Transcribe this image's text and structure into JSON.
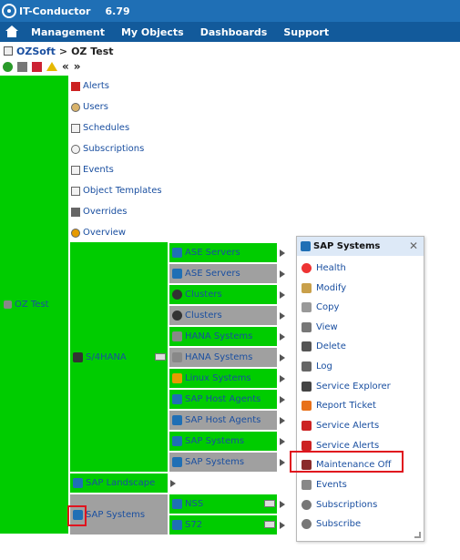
{
  "app": {
    "name": "IT-Conductor",
    "version": "6.79"
  },
  "nav": {
    "items": [
      "Management",
      "My Objects",
      "Dashboards",
      "Support"
    ]
  },
  "breadcrumb": {
    "root": "OZSoft",
    "separator": ">",
    "current": "OZ Test"
  },
  "toolbar": {
    "prev": "«",
    "next": "»"
  },
  "tree": {
    "root_label": "OZ Test",
    "sub_items": [
      "Alerts",
      "Users",
      "Schedules",
      "Subscriptions",
      "Events",
      "Object Templates",
      "Overrides",
      "Overview"
    ],
    "groups": {
      "s4hana": "S/4HANA",
      "landscape": "SAP Landscape",
      "sap_systems": "SAP Systems"
    },
    "s4hana_children": [
      "ASE Servers",
      "ASE Servers",
      "Clusters",
      "Clusters",
      "HANA Systems",
      "HANA Systems",
      "Linux Systems",
      "SAP Host Agents",
      "SAP Host Agents",
      "SAP Systems",
      "SAP Systems"
    ],
    "sap_systems_children": [
      "NSS",
      "S72"
    ]
  },
  "context_menu": {
    "title": "SAP Systems",
    "close": "✕",
    "items": [
      "Health",
      "Modify",
      "Copy",
      "View",
      "Delete",
      "Log",
      "Service Explorer",
      "Report Ticket",
      "Service Alerts",
      "Service Alerts",
      "Maintenance Off",
      "Events",
      "Subscriptions",
      "Subscribe"
    ]
  },
  "colors": {
    "header": "#1f6fb5",
    "nav": "#125a9b",
    "green": "#00cc00",
    "gray": "#a0a0a0",
    "highlight": "#e0141e"
  }
}
